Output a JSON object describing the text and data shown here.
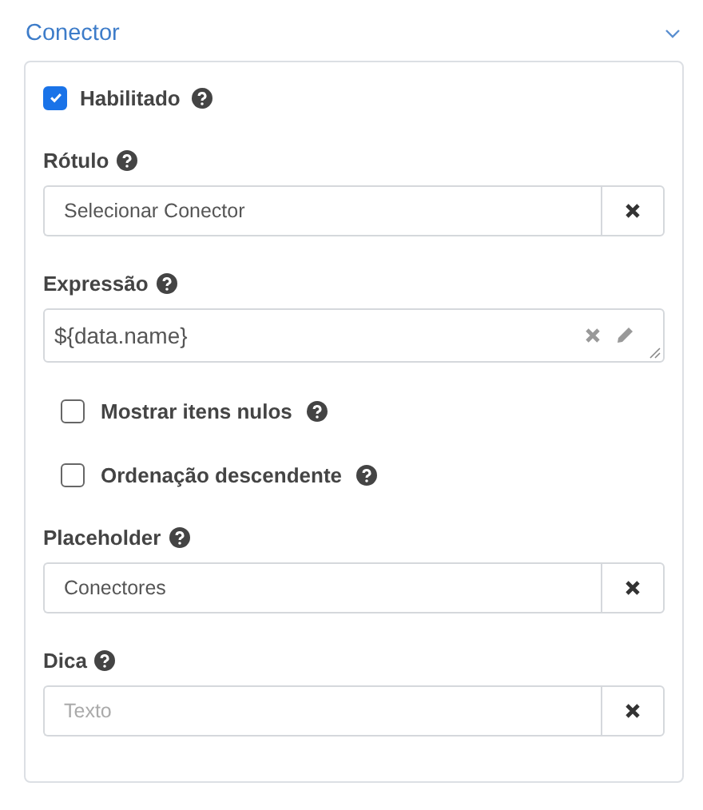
{
  "section": {
    "title": "Conector",
    "expanded": true
  },
  "items": [
    {
      "kind": "checkbox",
      "label": "Habilitado",
      "checked": true,
      "indented": false
    },
    {
      "kind": "field",
      "label": "Rótulo",
      "value": "Selecionar Conector"
    },
    {
      "kind": "expression",
      "label": "Expressão",
      "value": "${data.name}"
    },
    {
      "kind": "checkbox",
      "label": "Mostrar itens nulos",
      "checked": false,
      "indented": true
    },
    {
      "kind": "checkbox",
      "label": "Ordenação descendente",
      "checked": false,
      "indented": true
    },
    {
      "kind": "field",
      "label": "Placeholder",
      "value": "Conectores"
    },
    {
      "kind": "field",
      "label": "Dica",
      "placeholder": "Texto"
    }
  ]
}
